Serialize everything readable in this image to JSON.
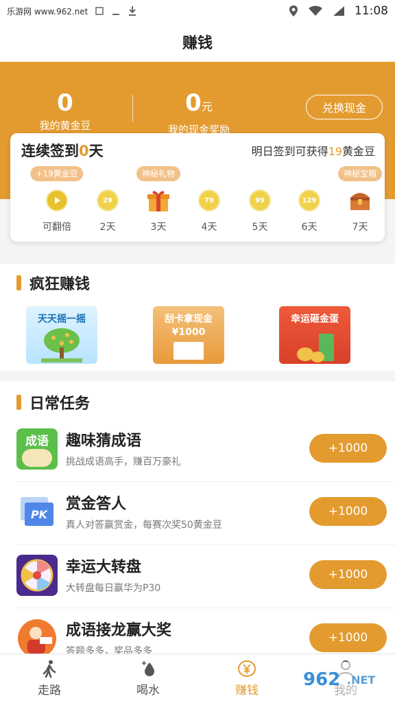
{
  "status_bar": {
    "site": "乐游网 www.962.net",
    "time": "11:08"
  },
  "header": {
    "title": "赚钱"
  },
  "stats": {
    "beans_value": "0",
    "beans_label": "我的黄金豆",
    "cash_value": "0",
    "cash_unit": "元",
    "cash_label": "我的现金奖励",
    "exchange_label": "兑换现金"
  },
  "signin": {
    "streak_prefix": "连续签到",
    "streak_days": "0",
    "streak_suffix": "天",
    "tomorrow_prefix": "明日签到可获得",
    "tomorrow_amount": "19",
    "tomorrow_suffix": "黄金豆",
    "days": [
      {
        "badge": "+19黄金豆",
        "coin": "",
        "label": "可翻倍",
        "type": "play"
      },
      {
        "badge": "",
        "coin": "29",
        "label": "2天",
        "type": "coin"
      },
      {
        "badge": "神秘礼物",
        "coin": "",
        "label": "3天",
        "type": "gift"
      },
      {
        "badge": "",
        "coin": "79",
        "label": "4天",
        "type": "coin"
      },
      {
        "badge": "",
        "coin": "99",
        "label": "5天",
        "type": "coin"
      },
      {
        "badge": "",
        "coin": "129",
        "label": "6天",
        "type": "coin"
      },
      {
        "badge": "神秘宝箱",
        "coin": "",
        "label": "7天",
        "type": "chest"
      }
    ]
  },
  "crazy": {
    "title": "疯狂赚钱",
    "promos": [
      {
        "label": "天天摇一摇"
      },
      {
        "label": "刮卡拿现金",
        "amount": "¥1000"
      },
      {
        "label": "幸运砸金蛋"
      }
    ]
  },
  "daily": {
    "title": "日常任务",
    "tasks": [
      {
        "name": "趣味猜成语",
        "desc": "挑战成语高手，赚百万豪礼",
        "reward": "+1000",
        "icon": "idiom-icon",
        "icon_text": "成语"
      },
      {
        "name": "赏金答人",
        "desc": "真人对答赢赏金，每赛次奖50黄金豆",
        "reward": "+1000",
        "icon": "pk-icon",
        "icon_text": "PK"
      },
      {
        "name": "幸运大转盘",
        "desc": "大转盘每日赢华为P30",
        "reward": "+1000",
        "icon": "wheel-icon",
        "icon_text": ""
      },
      {
        "name": "成语接龙赢大奖",
        "desc": "答题多多，奖品多多",
        "reward": "+1000",
        "icon": "idiom-chain-icon",
        "icon_text": ""
      }
    ]
  },
  "tabs": [
    {
      "label": "走路",
      "icon": "walk-icon",
      "active": false
    },
    {
      "label": "喝水",
      "icon": "water-icon",
      "active": false
    },
    {
      "label": "赚钱",
      "icon": "yen-icon",
      "active": true
    },
    {
      "label": "我的",
      "icon": "user-icon",
      "active": false
    }
  ],
  "colors": {
    "accent": "#e39b2f",
    "badge": "#f2c18a",
    "coin": "#f0d24a"
  }
}
